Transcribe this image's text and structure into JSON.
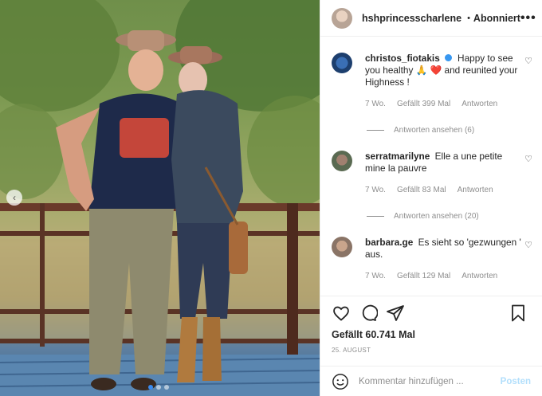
{
  "header": {
    "username": "hshprincesscharlene",
    "separator": "•",
    "follow_label": "Abonniert",
    "more_icon": "more-horizontal-icon"
  },
  "comments": [
    {
      "username": "christos_fiotakis",
      "verified": true,
      "text": "Happy to see you healthy 🙏 ❤️ and reunited your Highness !",
      "age": "7 Wo.",
      "likes": "Gefällt 399 Mal",
      "reply_label": "Antworten",
      "view_replies": "Antworten ansehen (6)"
    },
    {
      "username": "serratmarilyne",
      "text": "Elle a une petite mine la pauvre",
      "age": "7 Wo.",
      "likes": "Gefällt 83 Mal",
      "reply_label": "Antworten",
      "view_replies": "Antworten ansehen (20)"
    },
    {
      "username": "barbara.ge",
      "text": "Es sieht so 'gezwungen ' aus.",
      "age": "7 Wo.",
      "likes": "Gefällt 129 Mal",
      "reply_label": "Antworten"
    }
  ],
  "actions": {
    "like_icon": "heart-icon",
    "comment_icon": "comment-icon",
    "share_icon": "share-icon",
    "save_icon": "bookmark-icon"
  },
  "likes_text": "Gefällt 60.741 Mal",
  "date_text": "25. AUGUST",
  "composer": {
    "placeholder": "Kommentar hinzufügen ...",
    "post_label": "Posten"
  },
  "colors": {
    "verified": "#3897f0",
    "post_disabled": "#b2dffc",
    "text_muted": "#8e8e8e"
  }
}
